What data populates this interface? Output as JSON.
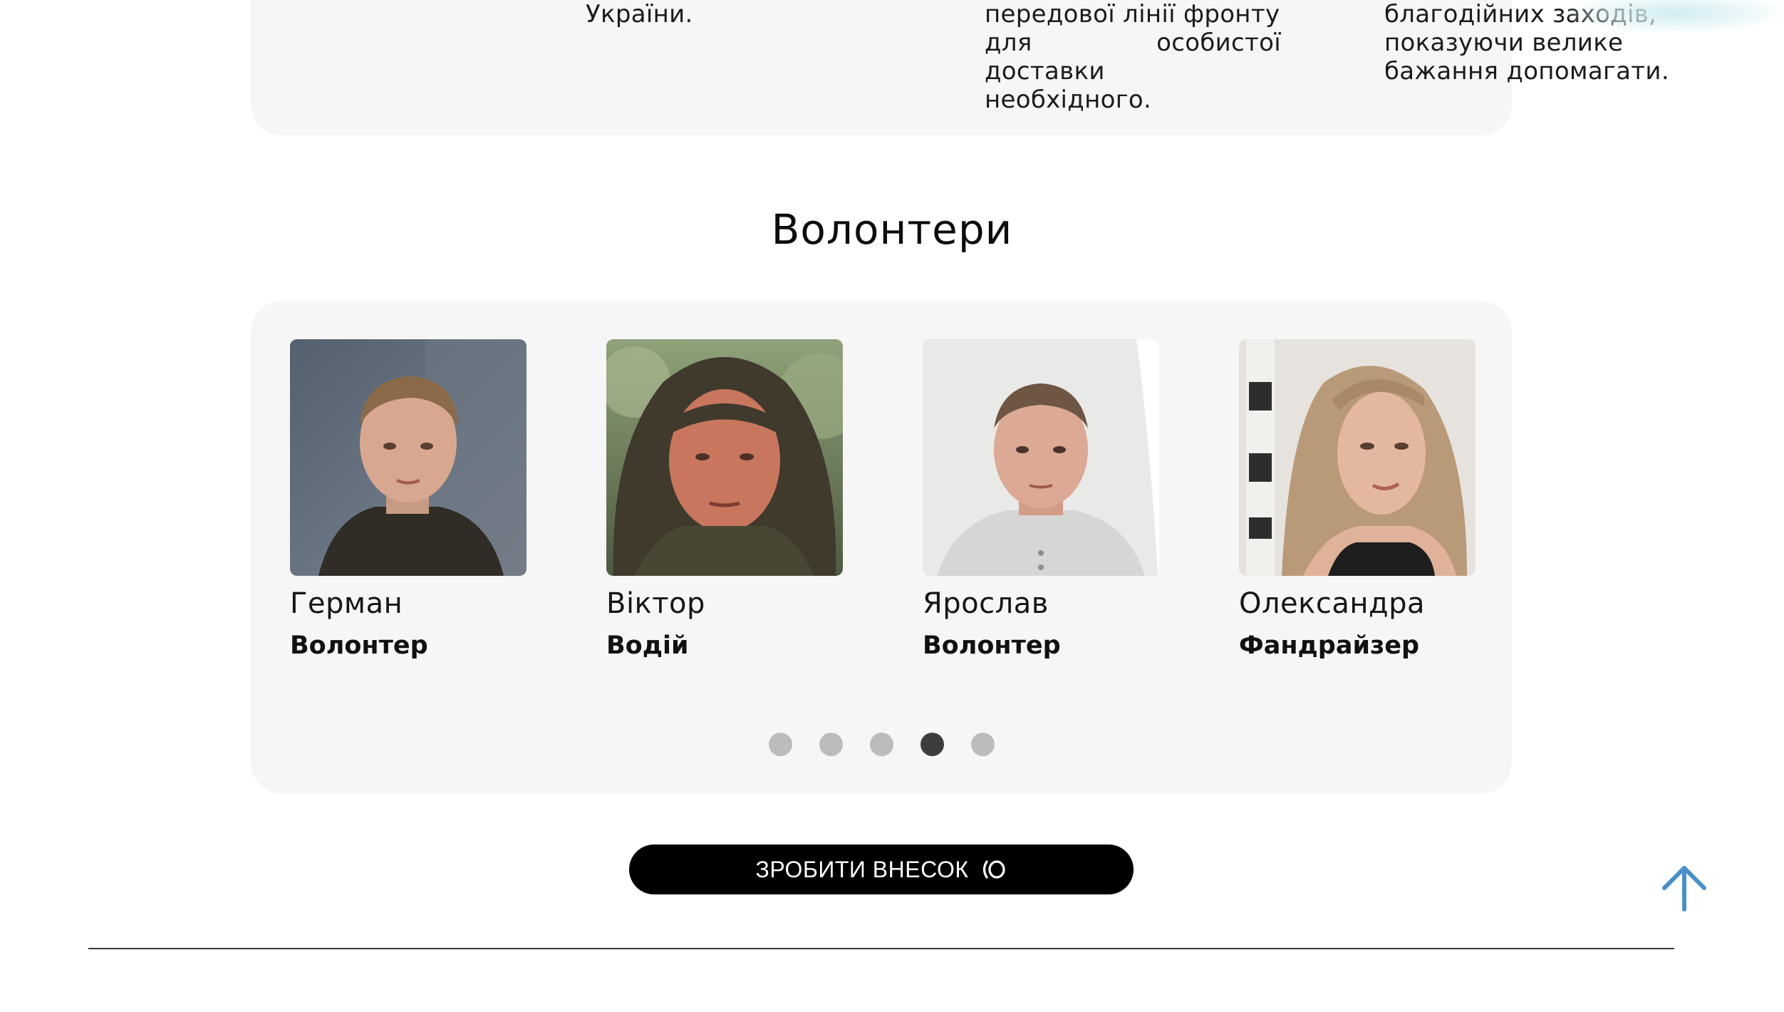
{
  "about": {
    "col1": [
      "України."
    ],
    "col2": [
      "передової лінії фронту",
      "для особистої доставки",
      "необхідного."
    ],
    "col3": [
      "благодійних заходів,",
      "показуючи велике",
      "бажання допомагати."
    ]
  },
  "volunteers": {
    "title": "Волонтери",
    "cards": [
      {
        "name": "Герман",
        "role": "Волонтер"
      },
      {
        "name": "Віктор",
        "role": "Водій"
      },
      {
        "name": "Ярослав",
        "role": "Волонтер"
      },
      {
        "name": "Олександра",
        "role": "Фандрайзер"
      }
    ],
    "pagination": {
      "count": 5,
      "active_index": 3
    }
  },
  "cta": {
    "label": "ЗРОБИТИ ВНЕСОК"
  },
  "colors": {
    "panel_bg": "#f6f6f6",
    "dot_inactive": "#bcbcbc",
    "dot_active": "#3d3d3d",
    "cta_bg": "#000000",
    "scroll_top_arrow": "#4a90c8"
  },
  "icons": {
    "cta": "heart-outline-icon",
    "scroll_top": "arrow-up-icon"
  }
}
